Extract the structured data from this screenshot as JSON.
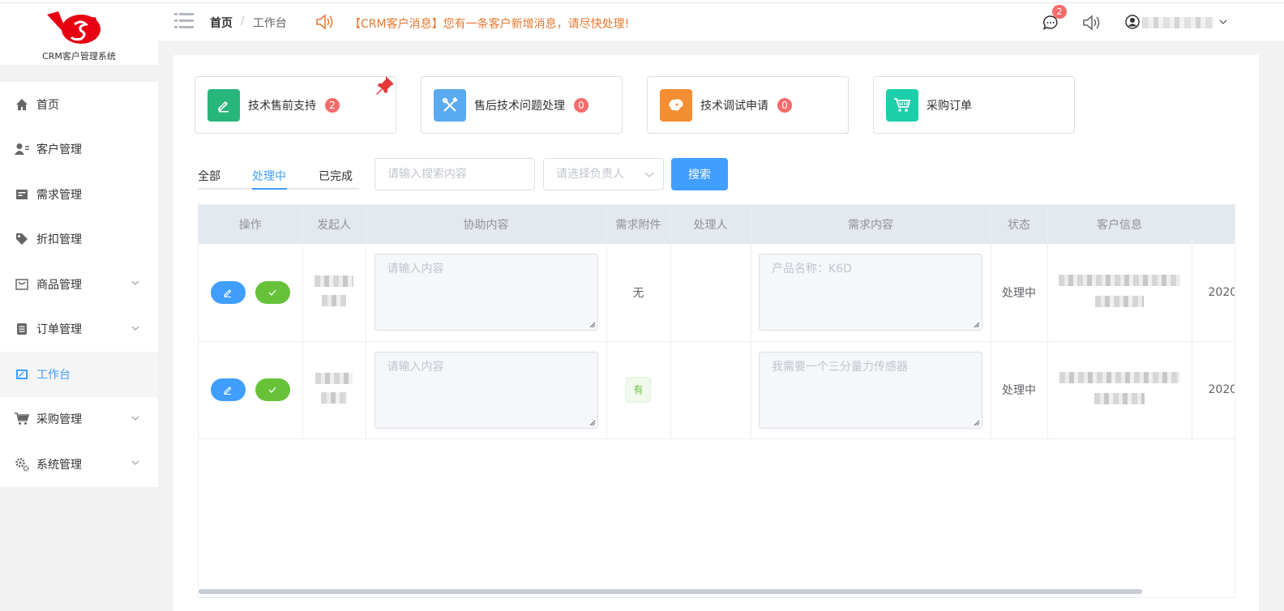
{
  "app": {
    "logo_text": "CRM客户管理系统",
    "colors": {
      "accent": "#409eff",
      "danger": "#f56c6c",
      "success": "#67c23a",
      "notice": "#e6762e",
      "logo": "#e60012"
    }
  },
  "sidebar": {
    "items": [
      {
        "label": "首页",
        "icon": "home-icon",
        "expandable": false,
        "active": false
      },
      {
        "label": "客户管理",
        "icon": "customer-icon",
        "expandable": false,
        "active": false
      },
      {
        "label": "需求管理",
        "icon": "requirement-icon",
        "expandable": false,
        "active": false
      },
      {
        "label": "折扣管理",
        "icon": "tag-icon",
        "expandable": false,
        "active": false
      },
      {
        "label": "商品管理",
        "icon": "goods-icon",
        "expandable": true,
        "active": false
      },
      {
        "label": "订单管理",
        "icon": "order-icon",
        "expandable": true,
        "active": false
      },
      {
        "label": "工作台",
        "icon": "workbench-icon",
        "expandable": false,
        "active": true
      },
      {
        "label": "采购管理",
        "icon": "cart-icon",
        "expandable": true,
        "active": false
      },
      {
        "label": "系统管理",
        "icon": "settings-icon",
        "expandable": true,
        "active": false
      }
    ]
  },
  "header": {
    "breadcrumb": [
      "首页",
      "工作台"
    ],
    "breadcrumb_sep": "/",
    "notice": "【CRM客户消息】您有一条客户新增消息，请尽快处理!",
    "message_badge": "2"
  },
  "quick_cards": [
    {
      "label": "技术售前支持",
      "badge": "2",
      "icon": "pen-icon",
      "color": "#27b67b",
      "pinned": true
    },
    {
      "label": "售后技术问题处理",
      "badge": "0",
      "icon": "tools-icon",
      "color": "#5aaaf0",
      "pinned": false
    },
    {
      "label": "技术调试申请",
      "badge": "0",
      "icon": "map-icon",
      "color": "#f58e33",
      "pinned": false
    },
    {
      "label": "采购订单",
      "badge": null,
      "icon": "shopping-cart-icon",
      "color": "#1ccfab",
      "pinned": false
    }
  ],
  "filters": {
    "tabs": [
      "全部",
      "处理中",
      "已完成"
    ],
    "active_tab": 1,
    "search_placeholder": "请输入搜索内容",
    "owner_placeholder": "请选择负责人",
    "search_button": "搜索"
  },
  "table": {
    "columns": [
      "操作",
      "发起人",
      "协助内容",
      "需求附件",
      "处理人",
      "需求内容",
      "状态",
      "客户信息",
      ""
    ],
    "rows": [
      {
        "assist_placeholder": "请输入内容",
        "attachment": "无",
        "attachment_tag": false,
        "requirement_placeholder": "产品名称：K6D",
        "status": "处理中",
        "date": "2020"
      },
      {
        "assist_placeholder": "请输入内容",
        "attachment": "有",
        "attachment_tag": true,
        "requirement_placeholder": "我需要一个三分量力传感器",
        "status": "处理中",
        "date": "2020"
      }
    ]
  }
}
